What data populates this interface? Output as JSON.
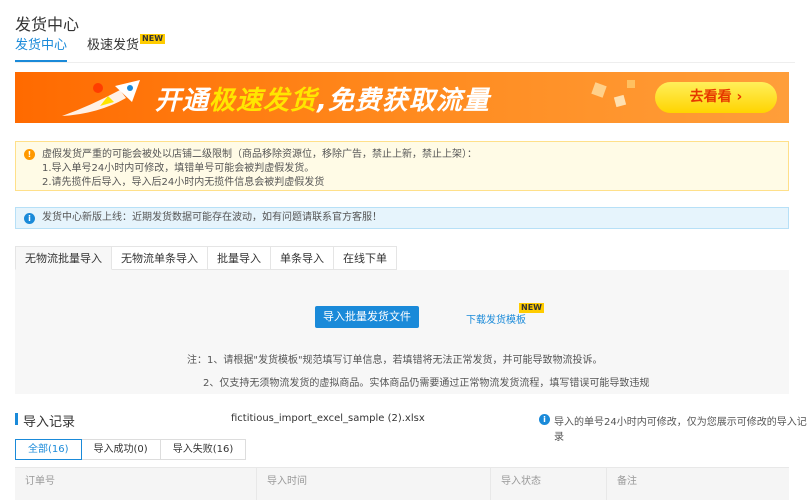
{
  "page_title": "发货中心",
  "top_tabs": [
    {
      "label": "发货中心",
      "active": true
    },
    {
      "label": "极速发货",
      "badge": "NEW"
    }
  ],
  "banner": {
    "prefix": "开通",
    "highlight": "极速发货",
    "suffix": ",免费获取流量",
    "button": "去看看 ›",
    "colors": {
      "bg": "#ff7a10",
      "highlight": "#ffe600",
      "button": "#ffd400"
    }
  },
  "warning": {
    "line1": "虚假发货严重的可能会被处以店铺二级限制（商品移除资源位，移除广告，禁止上新，禁止上架）：",
    "line2": "1.导入单号24小时内可修改，填错单号可能会被判虚假发货。",
    "line3": "2.请先揽件后导入，导入后24小时内无揽件信息会被判虚假发货"
  },
  "info": {
    "text": "发货中心新版上线：近期发货数据可能存在波动，如有问题请联系官方客服！"
  },
  "sub_tabs": [
    "无物流批量导入",
    "无物流单条导入",
    "批量导入",
    "单条导入",
    "在线下单"
  ],
  "upload": {
    "button": "导入批量发货文件",
    "download": "下载发货模板",
    "download_badge": "NEW",
    "note1": "注：1、请根据\"发货模板\"规范填写订单信息，若填错将无法正常发货，并可能导致物流投诉。",
    "note2": "2、仅支持无须物流发货的虚拟商品。实体商品仍需要通过正常物流发货流程，填写错误可能导致违规"
  },
  "records": {
    "title": "导入记录",
    "file": "fictitious_import_excel_sample (2).xlsx",
    "tip": "导入的单号24小时内可修改，仅为您展示可修改的导入记录",
    "filters": [
      "全部(16)",
      "导入成功(0)",
      "导入失败(16)"
    ],
    "columns": [
      "订单号",
      "导入时间",
      "导入状态",
      "备注"
    ]
  }
}
